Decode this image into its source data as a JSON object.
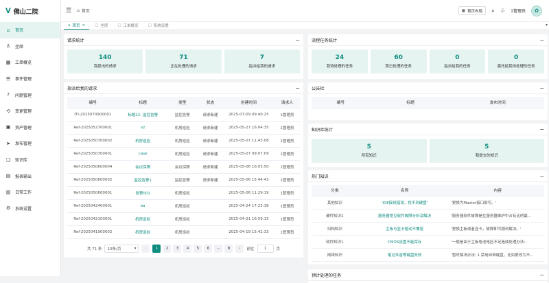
{
  "app": {
    "logo_text": "佛山二院"
  },
  "sidebar": {
    "items": [
      {
        "label": "首页",
        "icon": "home-icon",
        "glyph": "⌂",
        "active": true
      },
      {
        "label": "坐席",
        "icon": "seat-icon",
        "glyph": "♙"
      },
      {
        "label": "工单概览",
        "icon": "grid-icon",
        "glyph": "▦"
      },
      {
        "label": "事件管理",
        "icon": "list-icon",
        "glyph": "☰"
      },
      {
        "label": "问题管理",
        "icon": "question-icon",
        "glyph": "?"
      },
      {
        "label": "变更管理",
        "icon": "change-icon",
        "glyph": "⟲"
      },
      {
        "label": "资产管理",
        "icon": "asset-icon",
        "glyph": "▣"
      },
      {
        "label": "发布管理",
        "icon": "send-icon",
        "glyph": "➤"
      },
      {
        "label": "知识库",
        "icon": "book-icon",
        "glyph": "❏"
      },
      {
        "label": "报表输出",
        "icon": "report-icon",
        "glyph": "▤"
      },
      {
        "label": "日常工作",
        "icon": "calendar-icon",
        "glyph": "▥"
      },
      {
        "label": "系统设置",
        "icon": "gear-icon",
        "glyph": "⚙"
      }
    ]
  },
  "header": {
    "breadcrumb": "首页",
    "layout_button": "首页布局",
    "user": "1管理员"
  },
  "tabs": [
    {
      "label": "首页",
      "active": true,
      "closable": true
    },
    {
      "label": "坐席"
    },
    {
      "label": "工单概览"
    },
    {
      "label": "系统设置"
    }
  ],
  "request_stats": {
    "title": "请求统计",
    "items": [
      {
        "value": "140",
        "label": "我提出的请求"
      },
      {
        "value": "71",
        "label": "正在处理的请求"
      },
      {
        "value": "7",
        "label": "指派给我的请求"
      }
    ]
  },
  "flow_stats": {
    "title": "流程任务统计",
    "items": [
      {
        "value": "24",
        "label": "我待处理的任务"
      },
      {
        "value": "60",
        "label": "我已处理的任务"
      },
      {
        "value": "0",
        "label": "指派给我的任务"
      },
      {
        "value": "0",
        "label": "委托给我待处理的任务"
      }
    ]
  },
  "assigned": {
    "title": "指派给我的请求",
    "columns": [
      "编号",
      "标题",
      "类型",
      "状态",
      "创建时间",
      "请求人"
    ],
    "rows": [
      [
        "ITI-2025070900001",
        "标题22--监控告警",
        "监控告警",
        "请求新建",
        "2025-07-09 09:40:25",
        "1管理员"
      ],
      [
        "Ref-2025052700001",
        "xz",
        "机房巡检",
        "请求新建",
        "2025-05-27 16:04:35",
        "1管理员"
      ],
      [
        "Ref-2025050700002",
        "机房巡检",
        "机房巡检",
        "请求新建",
        "2025-05-07 11:43:08",
        "1管理员"
      ],
      [
        "Ref-2025050700001",
        "case",
        "机房巡检",
        "请求新建",
        "2025-05-07 09:07:09",
        "1管理员"
      ],
      [
        "Ref-2025050600004",
        "会议保障",
        "会议保障",
        "请求新建",
        "2025-05-06 16:03:50",
        "1管理员"
      ],
      [
        "Ref-2025050600002",
        "监控告警1",
        "监控告警",
        "请求新建",
        "2025-05-06 15:44:43",
        "1管理员"
      ],
      [
        "Ref-2025050600001",
        "告警001",
        "机房巡检",
        "",
        "2025-05-06 11:29:19",
        "1管理员"
      ],
      [
        "Ref-2025042400001",
        "aa",
        "机房巡检",
        "",
        "2025-04-24 17:23:38",
        "1管理员"
      ],
      [
        "Ref-2025042100001",
        "机房巡检",
        "机房巡检",
        "",
        "2025-04-21 16:59:15",
        "1管理员"
      ],
      [
        "Ref-2025041900002",
        "机房巡检",
        "机房巡检",
        "",
        "2025-04-19 15:42:33",
        "1管理员"
      ]
    ],
    "pager": {
      "total": "共 71 条",
      "page_size": "10条/页",
      "pages": [
        "1",
        "2",
        "3",
        "4",
        "5",
        "6",
        "···",
        "8"
      ],
      "goto_label": "前往",
      "goto_value": "1",
      "page_unit": "页"
    }
  },
  "bulletin": {
    "title": "公告栏",
    "columns": [
      "编号",
      "标题",
      "发布时间"
    ]
  },
  "knowledge_stats": {
    "title": "知识库统计",
    "items": [
      {
        "value": "5",
        "label": "所有知识"
      },
      {
        "value": "5",
        "label": "我提交的知识"
      }
    ]
  },
  "hot_knowledge": {
    "title": "热门知识",
    "columns": [
      "分类",
      "名称",
      "内容"
    ],
    "rows": [
      [
        "其他知识",
        "'IDE接线错误，找不到硬盘'",
        "'更换为Master接口即可。'"
      ],
      [
        "硬件知识2",
        "服务器常见软件故障分析及解决",
        "'服务器软件故障是在服务器维护中占有比例最..."
      ],
      [
        "归档知识",
        "主板与显卡驱动不兼容",
        "'更换主板或者显卡，故障即可顺利解决。'"
      ],
      [
        "软件知识1",
        "CMOS设置不能保存",
        "'一般是由于主板电池电压不足造成处理办法:..."
      ],
      [
        "网络知识",
        "笔记本音等键盘失效",
        "'暂时解决办法: 1.禁用自带键盘，比如更改为不..."
      ]
    ]
  },
  "more_panel": {
    "title": "预计处理的任务"
  }
}
